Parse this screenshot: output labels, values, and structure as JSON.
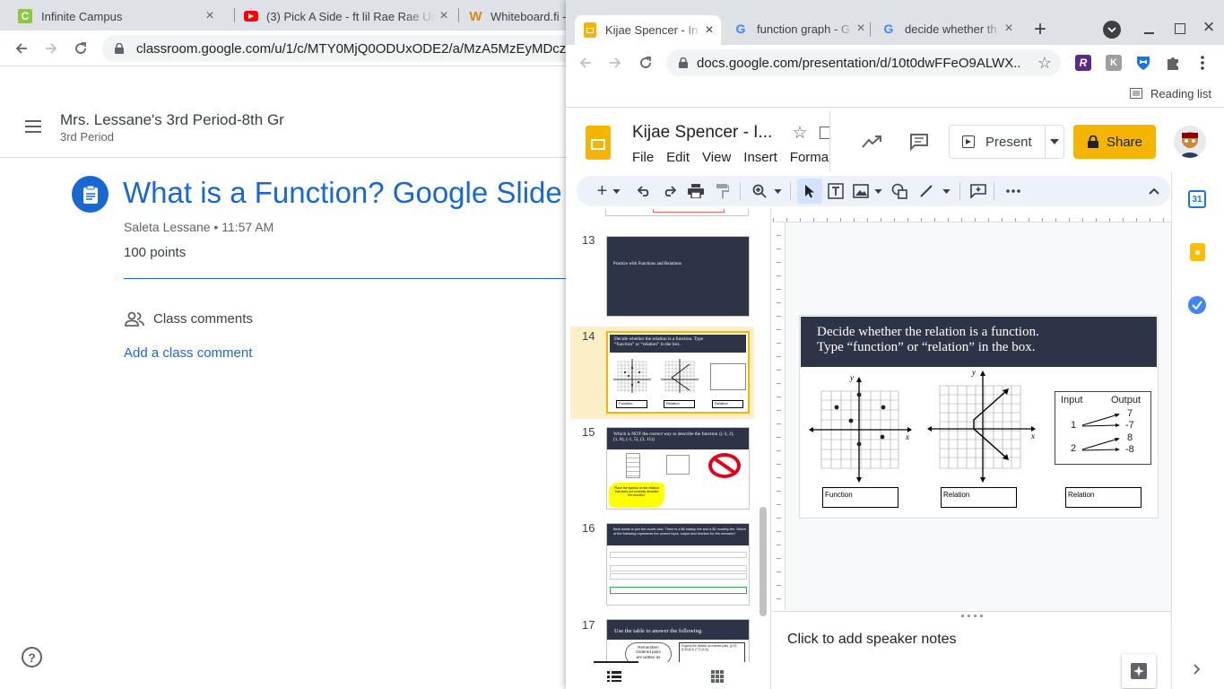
{
  "left_window": {
    "tabs": [
      {
        "title": "Infinite Campus",
        "icon": "infinite-campus-icon"
      },
      {
        "title": "(3) Pick A Side - ft lil Rae Rae Un",
        "icon": "youtube-icon"
      },
      {
        "title": "Whiteboard.fi -",
        "icon": "whiteboard-fi-icon"
      }
    ],
    "url": "classroom.google.com/u/1/c/MTY0MjQ0ODUxODE2/a/MzA5MzEyMDcz",
    "class_name": "Mrs. Lessane's 3rd Period-8th Gr",
    "class_section": "3rd Period",
    "assignment_title": "What is a Function? Google Slide",
    "author_time": "Saleta Lessane • 11:57 AM",
    "points": "100 points",
    "comments_heading": "Class comments",
    "add_comment": "Add a class comment"
  },
  "right_window": {
    "tabs": [
      {
        "title": "Kijae Spencer - In",
        "icon": "google-slides-icon",
        "active": true
      },
      {
        "title": "function graph - G",
        "icon": "google-icon",
        "active": false
      },
      {
        "title": "decide whether th",
        "icon": "google-icon",
        "active": false
      }
    ],
    "url": "docs.google.com/presentation/d/10t0dwFFeO9ALWX...",
    "reading_list": "Reading list",
    "doc_title": "Kijae Spencer - I...",
    "menu": [
      "File",
      "Edit",
      "View",
      "Insert",
      "Forma"
    ],
    "present_label": "Present",
    "share_label": "Share",
    "speaker_notes": "Click to add speaker notes"
  },
  "slides": [
    {
      "num": "13",
      "title": "Practice with Functions and Relations"
    },
    {
      "num": "14",
      "title": "Decide whether the relation is a function. Type “function” or “relation” in the box.",
      "answers": [
        "Function",
        "Relation",
        "Relation"
      ]
    },
    {
      "num": "15",
      "title": "Which is NOT the correct way to describe the function {(-3, 2), (1, 8), (-1, 5), (3, 11)}",
      "note": "Place the symbol on the relation that does not correctly describe the function."
    },
    {
      "num": "16",
      "title": "Beth wants to join the movie club. There is a $5 startup fee and a $2 monthly fee. Which of the following represents the correct input, output and function for the scenario?"
    },
    {
      "num": "17",
      "title": "Use the table to answer the following.",
      "cloud": "Remember! Ordered pairs are written as",
      "box": "Express the relation as ordered pairs. {(4,9) (5,5) (6,9) (7,7) (3,2)}"
    }
  ],
  "main_slide": {
    "title_line1": "Decide whether the relation is a function.",
    "title_line2": "Type “function” or “relation” in the box.",
    "axis_x": "x",
    "axis_y": "y",
    "mapping": {
      "input_label": "Input",
      "output_label": "Output",
      "inputs": [
        "1",
        "2"
      ],
      "outputs": [
        "7",
        "-7",
        "8",
        "-8"
      ]
    },
    "answers": [
      "Function",
      "Relation",
      "Relation"
    ]
  }
}
